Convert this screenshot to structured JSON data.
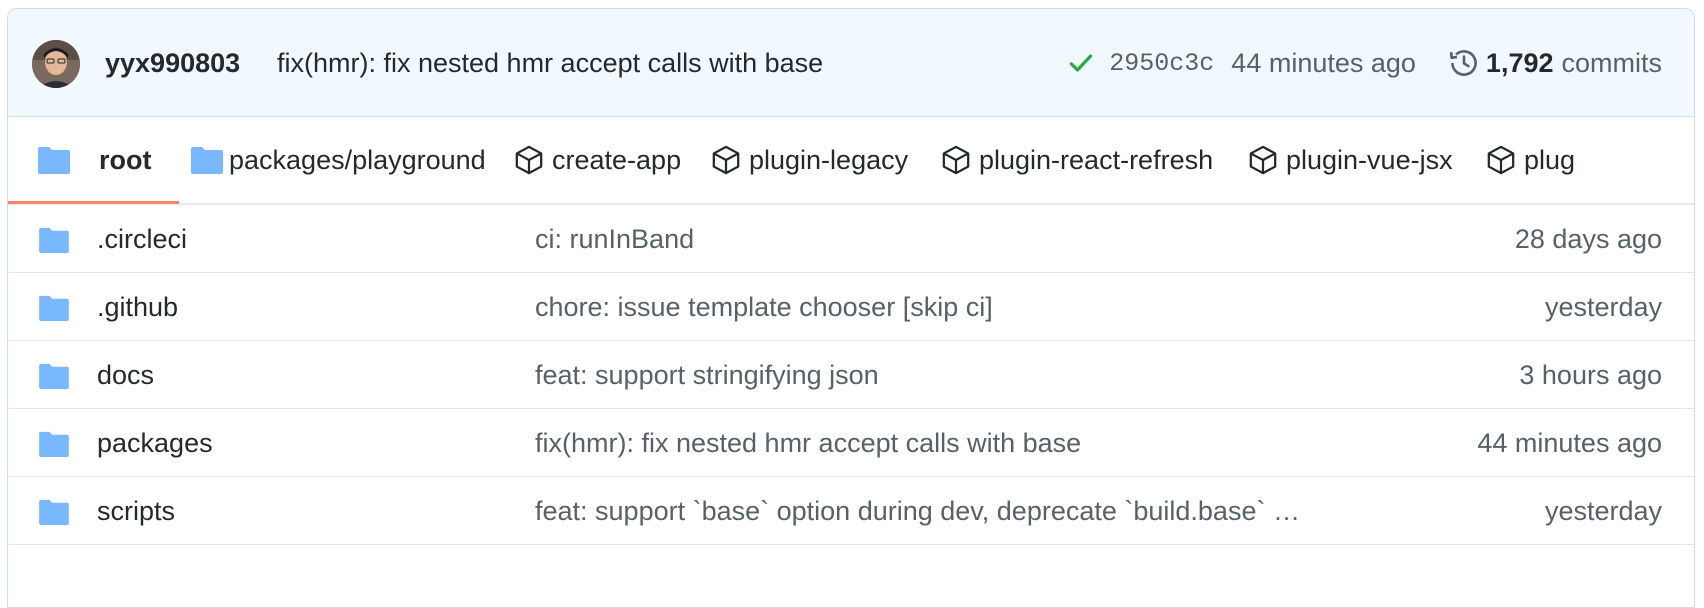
{
  "commit": {
    "author": "yyx990803",
    "message": "fix(hmr): fix nested hmr accept calls with base",
    "sha": "2950c3c",
    "time_ago": "44 minutes ago",
    "commits_count": "1,792",
    "commits_label": "commits",
    "status_color": "#28a745"
  },
  "tabs": [
    {
      "label": "root",
      "icon": "folder-icon",
      "active": true
    },
    {
      "label": "packages/playground",
      "icon": "folder-icon"
    },
    {
      "label": "create-app",
      "icon": "package-icon"
    },
    {
      "label": "plugin-legacy",
      "icon": "package-icon"
    },
    {
      "label": "plugin-react-refresh",
      "icon": "package-icon"
    },
    {
      "label": "plugin-vue-jsx",
      "icon": "package-icon"
    },
    {
      "label": "plug",
      "icon": "package-icon"
    }
  ],
  "files": [
    {
      "name": ".circleci",
      "message": "ci: runInBand",
      "age": "28 days ago"
    },
    {
      "name": ".github",
      "message": "chore: issue template chooser [skip ci]",
      "age": "yesterday"
    },
    {
      "name": "docs",
      "message": "feat: support stringifying json",
      "age": "3 hours ago"
    },
    {
      "name": "packages",
      "message": "fix(hmr): fix nested hmr accept calls with base",
      "age": "44 minutes ago"
    },
    {
      "name": "scripts",
      "message": "feat: support `base` option during dev, deprecate `build.base` …",
      "age": "yesterday"
    }
  ],
  "colors": {
    "folder": "#79b8ff",
    "accent_underline": "#f9826c",
    "header_bg": "#f1f8ff"
  }
}
